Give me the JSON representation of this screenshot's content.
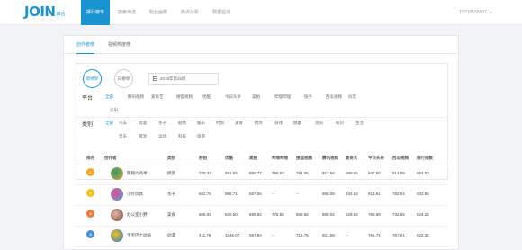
{
  "header": {
    "logo": "JOIN",
    "logo_sub": "四合",
    "nav": [
      {
        "label": "排行榜单",
        "active": true
      },
      {
        "label": "搜索筛选",
        "active": false
      },
      {
        "label": "粉丝画像",
        "active": false
      },
      {
        "label": "热点分析",
        "active": false
      },
      {
        "label": "数据监测",
        "active": false
      }
    ],
    "user": "15210155807"
  },
  "tabs": [
    {
      "label": "创作者榜",
      "active": true
    },
    {
      "label": "视频热度榜",
      "active": false
    }
  ],
  "filters": {
    "week_button": "周榜单",
    "day_button": "日榜单",
    "date_value": "2018年第25周",
    "platform_label": "平台",
    "platforms_row1": [
      "全部",
      "腾讯视频",
      "爱奇艺",
      "搜狐视频",
      "优酷",
      "今日头条",
      "美拍",
      "哔哩哔哩",
      "快手",
      "西瓜视频",
      "抖音"
    ],
    "platforms_row2": [
      "火山"
    ],
    "category_label": "类别",
    "categories_row1": [
      "全部",
      "汽车",
      "动漫",
      "亲子",
      "剧情",
      "娱乐",
      "时尚",
      "美食",
      "搞笑",
      "游戏",
      "健康",
      "资讯",
      "知识",
      "生活"
    ],
    "categories_row2": [
      "音乐",
      "萌宠",
      "运动",
      "科技",
      "旅游"
    ]
  },
  "table": {
    "headers": [
      "排名",
      "创作者",
      "",
      "类别",
      "秒拍",
      "优酷",
      "美拍",
      "哔哩哔哩",
      "搜狐视频",
      "腾讯视频",
      "爱奇艺",
      "今日头条",
      "西瓜视频",
      "排行指数"
    ],
    "rows": [
      {
        "rank": "1",
        "name": "陈翔六点半",
        "category": "搞笑",
        "values": [
          "729.37",
          "981.55",
          "890.77",
          "788.83",
          "794.06",
          "917.56",
          "969.65",
          "847.50",
          "814.08",
          "953.00"
        ],
        "colors": [
          "#2a9d6a",
          "#e9a23b"
        ]
      },
      {
        "rank": "2",
        "name": "小伶玩具",
        "category": "亲子",
        "values": [
          "662.75",
          "986.71",
          "657.06",
          "--",
          "--",
          "958.08",
          "934.54",
          "813.61",
          "782.04",
          "933.96"
        ],
        "colors": [
          "#e44b8d",
          "#46a8e0"
        ]
      },
      {
        "rank": "3",
        "name": "办公室小野",
        "category": "美食",
        "values": [
          "666.02",
          "820.50",
          "899.82",
          "778.50",
          "856.65",
          "889.02",
          "829.54",
          "768.99",
          "732.65",
          "924.22"
        ],
        "colors": [
          "#e3b7a8",
          "#7a4b3a"
        ]
      },
      {
        "rank": "4",
        "name": "宝宝巴士动画",
        "category": "动漫",
        "values": [
          "411.78",
          "1046.07",
          "587.84",
          "--",
          "715.75",
          "921.58",
          "--",
          "765.71",
          "767.01",
          "922.32"
        ],
        "colors": [
          "#f0c21f",
          "#2a78c8"
        ]
      }
    ]
  }
}
